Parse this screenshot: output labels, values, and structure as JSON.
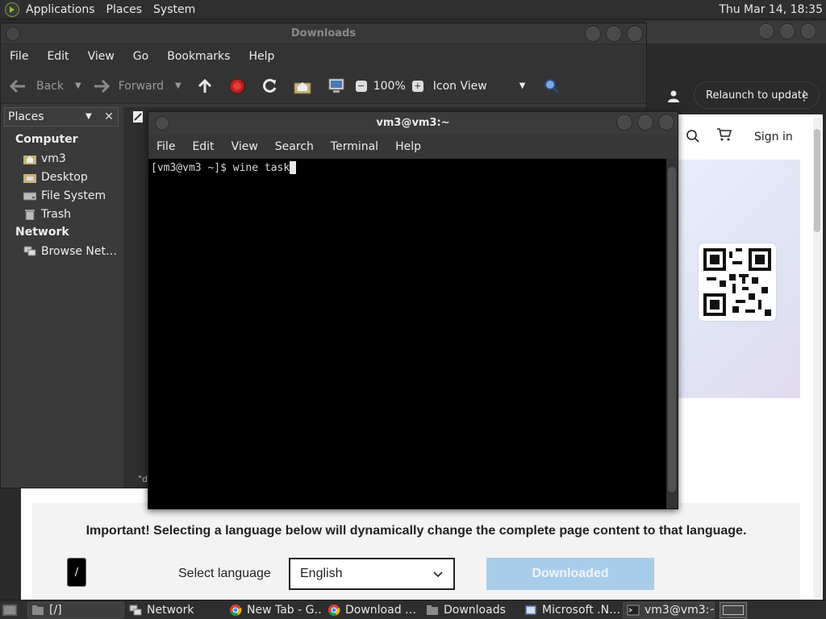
{
  "top_panel": {
    "menus": [
      "Applications",
      "Places",
      "System"
    ],
    "clock": "Thu Mar 14, 18:35"
  },
  "browser": {
    "relaunch_label": "Relaunch to update",
    "signin_label": "Sign in"
  },
  "webpage": {
    "important_text": "Important! Selecting a language below will dynamically change the complete page content to that language.",
    "select_language_label": "Select language",
    "language_value": "English",
    "download_button": "Downloaded",
    "slash_label": "/"
  },
  "nautilus": {
    "title": "Downloads",
    "menus": [
      "File",
      "Edit",
      "View",
      "Go",
      "Bookmarks",
      "Help"
    ],
    "toolbar": {
      "back": "Back",
      "forward": "Forward",
      "zoom": "100%",
      "view_mode": "Icon View"
    },
    "sidebar_title": "Places",
    "sidebar": {
      "computer_label": "Computer",
      "computer_items": [
        "vm3",
        "Desktop",
        "File System",
        "Trash"
      ],
      "network_label": "Network",
      "network_items": [
        "Browse Net…"
      ]
    },
    "status_text": "\"d"
  },
  "terminal": {
    "title": "vm3@vm3:~",
    "menus": [
      "File",
      "Edit",
      "View",
      "Search",
      "Terminal",
      "Help"
    ],
    "line": "[vm3@vm3 ~]$ wine task"
  },
  "taskbar": {
    "items": [
      "[/]",
      "Network",
      "New Tab - G…",
      "Download …",
      "Downloads",
      "Microsoft .N…",
      "vm3@vm3:~"
    ]
  },
  "colors": {
    "panel_bg": "#2f2f2f",
    "terminal_bg": "#000000",
    "download_btn": "#a8cdea"
  }
}
